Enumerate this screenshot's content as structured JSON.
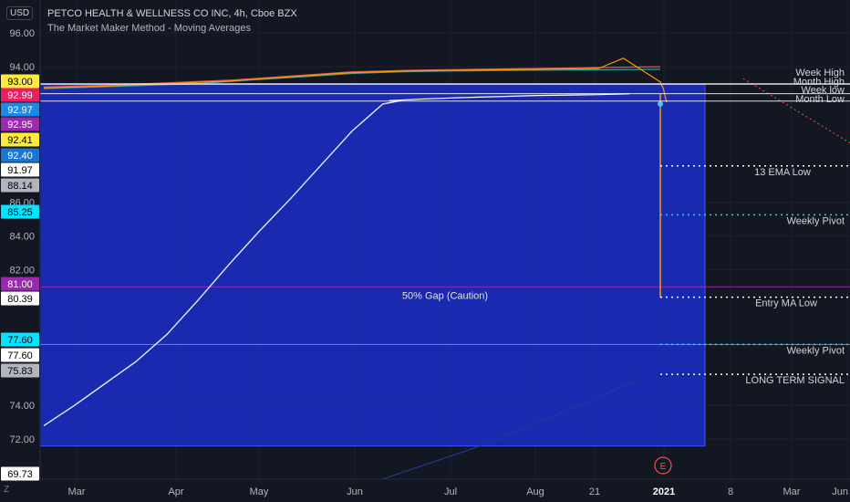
{
  "header": {
    "title": "PETCO HEALTH & WELLNESS CO INC, 4h, Cboe BZX",
    "indicator": "The Market Maker Method - Moving Averages",
    "currency": "USD",
    "scale_button": "Z"
  },
  "chart_data": {
    "type": "line",
    "title": "PETCO HEALTH & WELLNESS CO INC, 4h, Cboe BZX",
    "xlabel": "",
    "ylabel": "",
    "ylim": [
      69.0,
      97.2
    ],
    "grid": true,
    "y_ticks": [
      96.0,
      94.0,
      86.0,
      84.0,
      82.0,
      74.0,
      72.0
    ],
    "x_ticks": [
      "Mar",
      "Apr",
      "May",
      "Jun",
      "Jul",
      "Aug",
      "21",
      "2021",
      "8",
      "Mar",
      "Jun"
    ],
    "price_tags": [
      {
        "value": 93.0,
        "label": "93.00",
        "color": "#ffeb3b",
        "text_color": "#000000"
      },
      {
        "value": 92.99,
        "label": "92.99",
        "color": "#e91e63",
        "text_color": "#ffffff"
      },
      {
        "value": 92.97,
        "label": "92.97",
        "color": "#1e88e5",
        "text_color": "#ffffff"
      },
      {
        "value": 92.95,
        "label": "92.95",
        "color": "#9c27b0",
        "text_color": "#ffffff"
      },
      {
        "value": 92.41,
        "label": "92.41",
        "color": "#ffeb3b",
        "text_color": "#000000"
      },
      {
        "value": 92.4,
        "label": "92.40",
        "color": "#1976d2",
        "text_color": "#ffffff"
      },
      {
        "value": 91.97,
        "label": "91.97",
        "color": "#ffffff",
        "text_color": "#000000"
      },
      {
        "value": 88.14,
        "label": "88.14",
        "color": "#b2b5be",
        "text_color": "#000000"
      },
      {
        "value": 85.25,
        "label": "85.25",
        "color": "#00e5ff",
        "text_color": "#000000"
      },
      {
        "value": 81.0,
        "label": "81.00",
        "color": "#9c27b0",
        "text_color": "#ffffff"
      },
      {
        "value": 80.39,
        "label": "80.39",
        "color": "#ffffff",
        "text_color": "#000000"
      },
      {
        "value": 77.6,
        "label": "77.60",
        "color": "#00e5ff",
        "text_color": "#000000"
      },
      {
        "value": 77.6,
        "label": "77.60",
        "color": "#ffffff",
        "text_color": "#000000"
      },
      {
        "value": 75.83,
        "label": "75.83",
        "color": "#b2b5be",
        "text_color": "#000000"
      },
      {
        "value": 69.73,
        "label": "69.73",
        "color": "#ffffff",
        "text_color": "#000000"
      }
    ],
    "levels": [
      {
        "name": "Week High",
        "value": 93.0,
        "color": "#e1bee7",
        "style": "solid"
      },
      {
        "name": "Month High",
        "value": 92.97,
        "color": "#ffffff",
        "style": "solid"
      },
      {
        "name": "Week low",
        "value": 92.41,
        "color": "#ffffff",
        "style": "solid"
      },
      {
        "name": "Month Low",
        "value": 91.97,
        "color": "#ffffff",
        "style": "solid"
      },
      {
        "name": "13 EMA Low",
        "value": 88.14,
        "color": "#ffffff",
        "style": "dotted"
      },
      {
        "name": "Weekly Pivot",
        "value": 85.25,
        "color": "#00e5ff",
        "style": "dotted"
      },
      {
        "name": "Entry MA Low",
        "value": 80.39,
        "color": "#ffffff",
        "style": "dotted"
      },
      {
        "name": "Weekly Pivot",
        "value": 77.6,
        "color": "#00e5ff",
        "style": "dotted"
      },
      {
        "name": "LONG TERM SIGNAL",
        "value": 75.83,
        "color": "#ffffff",
        "style": "dotted"
      }
    ],
    "gap_zone": {
      "top": 92.95,
      "bottom": 71.6,
      "label": "50% Gap (Caution)",
      "mid_value": 81.0,
      "fill": "#1a2dc4"
    },
    "series": [
      {
        "name": "",
        "color": "#26a69a",
        "values": [
          [
            0,
            92.7
          ],
          [
            0.08,
            92.8
          ],
          [
            0.17,
            92.9
          ],
          [
            0.25,
            93.0
          ],
          [
            0.33,
            93.2
          ],
          [
            0.42,
            93.4
          ],
          [
            0.5,
            93.6
          ],
          [
            0.58,
            93.7
          ],
          [
            0.67,
            93.75
          ],
          [
            0.75,
            93.78
          ],
          [
            0.83,
            93.8
          ],
          [
            0.92,
            93.82
          ],
          [
            1.0,
            93.85
          ]
        ]
      },
      {
        "name": "",
        "color": "#ef5350",
        "values": [
          [
            0,
            92.8
          ],
          [
            0.1,
            92.9
          ],
          [
            0.2,
            93.05
          ],
          [
            0.3,
            93.2
          ],
          [
            0.4,
            93.45
          ],
          [
            0.5,
            93.7
          ],
          [
            0.6,
            93.8
          ],
          [
            0.7,
            93.85
          ],
          [
            0.8,
            93.9
          ],
          [
            0.9,
            93.95
          ],
          [
            1.0,
            94.0
          ]
        ]
      },
      {
        "name": "",
        "color": "#ff9800",
        "values": [
          [
            0,
            92.75
          ],
          [
            0.1,
            92.85
          ],
          [
            0.2,
            93.0
          ],
          [
            0.3,
            93.15
          ],
          [
            0.4,
            93.4
          ],
          [
            0.5,
            93.65
          ],
          [
            0.6,
            93.75
          ],
          [
            0.7,
            93.8
          ],
          [
            0.8,
            93.85
          ],
          [
            0.9,
            93.9
          ],
          [
            0.94,
            94.5
          ],
          [
            1.0,
            93.1
          ],
          [
            1.005,
            92.7
          ],
          [
            1.01,
            91.9
          ]
        ]
      },
      {
        "name": "",
        "color": "#ffffff",
        "values": [
          [
            0.56,
            92.0
          ],
          [
            0.62,
            92.1
          ],
          [
            0.7,
            92.2
          ],
          [
            0.8,
            92.3
          ],
          [
            0.9,
            92.35
          ],
          [
            0.95,
            92.4
          ]
        ]
      },
      {
        "name": "",
        "color": "#e8eaf6",
        "values": [
          [
            0,
            72.8
          ],
          [
            0.05,
            74.0
          ],
          [
            0.1,
            75.3
          ],
          [
            0.15,
            76.6
          ],
          [
            0.2,
            78.2
          ],
          [
            0.25,
            80.2
          ],
          [
            0.3,
            82.3
          ],
          [
            0.35,
            84.3
          ],
          [
            0.4,
            86.2
          ],
          [
            0.45,
            88.2
          ],
          [
            0.5,
            90.2
          ],
          [
            0.55,
            91.8
          ],
          [
            0.58,
            92.0
          ]
        ]
      },
      {
        "name": "",
        "color": "#283593",
        "values": [
          [
            0.53,
            69.4
          ],
          [
            0.7,
            71.5
          ],
          [
            0.85,
            73.7
          ],
          [
            0.97,
            75.6
          ]
        ]
      }
    ],
    "last_price": {
      "value": 92.6,
      "color": "#26a69a"
    },
    "earnings_marker": "E"
  }
}
